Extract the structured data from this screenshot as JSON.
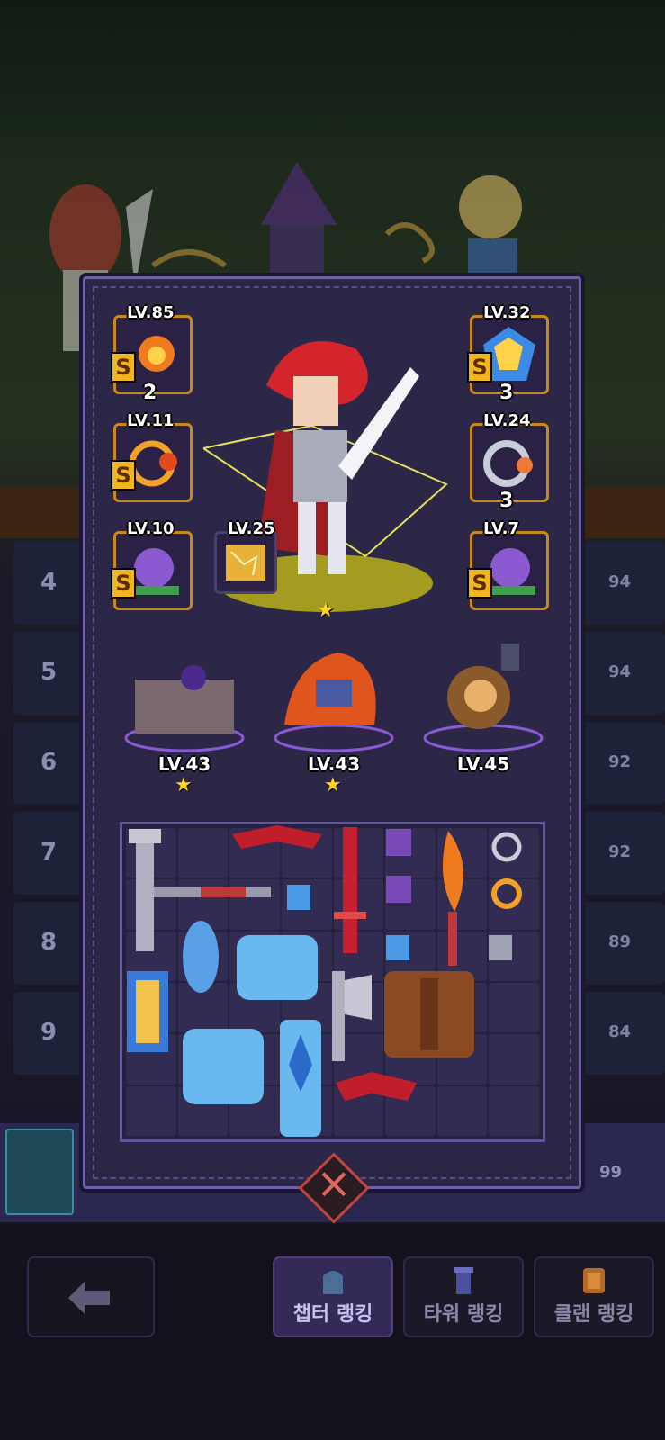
{
  "ranking_rows": [
    {
      "rank": "4",
      "score": "94"
    },
    {
      "rank": "5",
      "score": "94"
    },
    {
      "rank": "6",
      "score": "92"
    },
    {
      "rank": "7",
      "score": "92"
    },
    {
      "rank": "8",
      "score": "89"
    },
    {
      "rank": "9",
      "score": "84"
    }
  ],
  "my_row": {
    "score": "99"
  },
  "equipment": {
    "left": [
      {
        "level": "LV.85",
        "count": "2",
        "s": "S"
      },
      {
        "level": "LV.11",
        "count": "",
        "s": "S"
      },
      {
        "level": "LV.10",
        "count": "",
        "s": "S"
      }
    ],
    "right": [
      {
        "level": "LV.32",
        "count": "3",
        "s": "S"
      },
      {
        "level": "LV.24",
        "count": "3",
        "s": ""
      },
      {
        "level": "LV.7",
        "count": "",
        "s": "S"
      }
    ],
    "extra": {
      "level": "LV.25"
    }
  },
  "pets": [
    {
      "level": "LV.43",
      "star": "★"
    },
    {
      "level": "LV.43",
      "star": "★"
    },
    {
      "level": "LV.45",
      "star": ""
    }
  ],
  "hero_star": "★",
  "bottom_tabs": [
    {
      "label": "챕터 랭킹",
      "icon": "tombstone-icon"
    },
    {
      "label": "타워 랭킹",
      "icon": "tower-icon"
    },
    {
      "label": "클랜 랭킹",
      "icon": "clan-shield-icon"
    }
  ],
  "colors": {
    "accent": "#6f62a8",
    "gold": "#c98a1c",
    "close": "#c0463c"
  }
}
